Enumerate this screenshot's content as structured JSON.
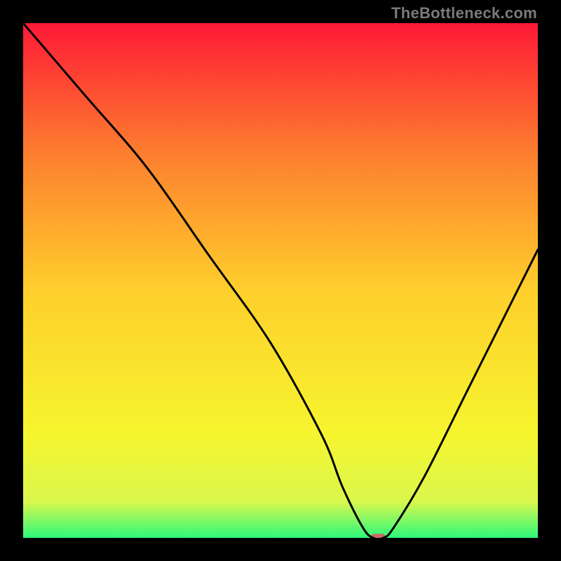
{
  "watermark": "TheBottleneck.com",
  "chart_data": {
    "type": "line",
    "title": "",
    "xlabel": "",
    "ylabel": "",
    "xlim": [
      0,
      100
    ],
    "ylim": [
      0,
      100
    ],
    "grid": false,
    "legend": false,
    "background_gradient": {
      "top": "#fe1936",
      "mid": "#fecf2c",
      "bottom": "#2cf97b"
    },
    "series": [
      {
        "name": "bottleneck-curve",
        "color": "#000000",
        "x": [
          0,
          12,
          24,
          36,
          48,
          58,
          62,
          66,
          68,
          70,
          72,
          78,
          86,
          94,
          100
        ],
        "y": [
          100,
          86,
          72,
          55,
          38,
          20,
          10,
          2,
          0,
          0,
          2,
          12,
          28,
          44,
          56
        ]
      }
    ],
    "marker": {
      "name": "highlight-marker",
      "x": 69,
      "y": 0,
      "color": "#cb6c62",
      "width_pct": 3.0,
      "height_pct": 1.6
    }
  }
}
